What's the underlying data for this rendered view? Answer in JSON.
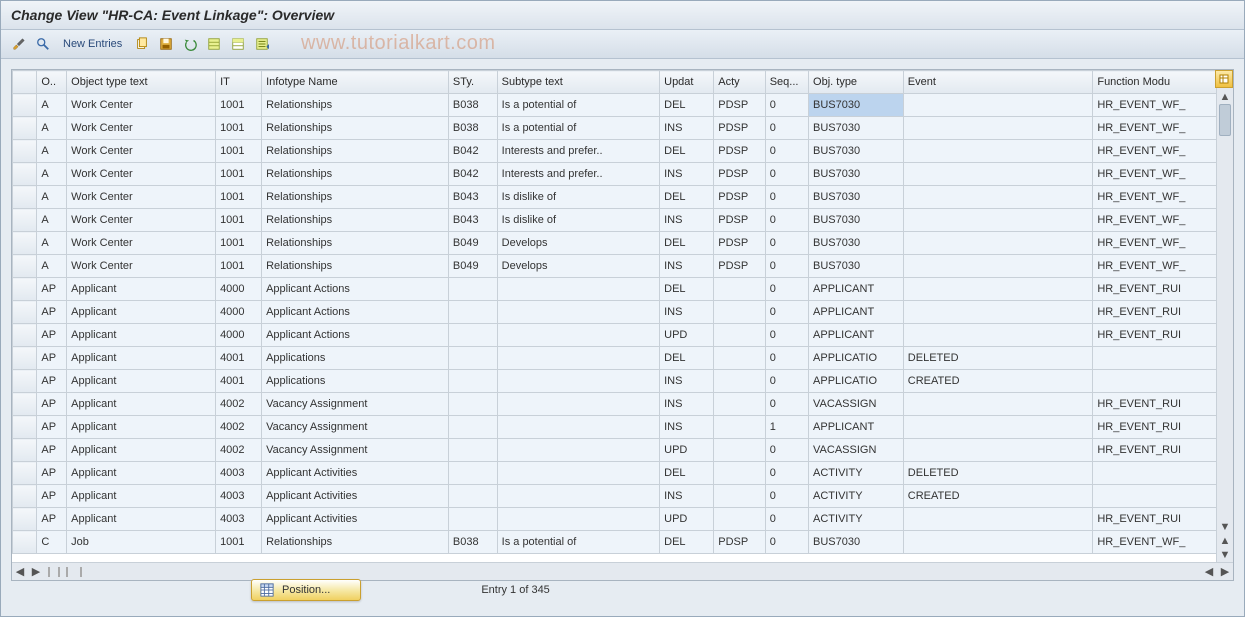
{
  "title": "Change View \"HR-CA: Event Linkage\": Overview",
  "watermark": "www.tutorialkart.com",
  "toolbar": {
    "new_entries_label": "New Entries"
  },
  "columns": {
    "sel": "",
    "o": "O..",
    "ott": "Object type text",
    "it": "IT",
    "iname": "Infotype Name",
    "sty": "STy.",
    "stxt": "Subtype text",
    "upd": "Updat",
    "acty": "Acty",
    "seq": "Seq...",
    "obj": "Obj. type",
    "event": "Event",
    "fm": "Function Modu"
  },
  "rows": [
    {
      "o": "A",
      "ott": "Work Center",
      "it": "1001",
      "iname": "Relationships",
      "sty": "B038",
      "stxt": "Is a potential of",
      "upd": "DEL",
      "acty": "PDSP",
      "seq": "0",
      "obj": "BUS7030",
      "event": "",
      "fm": "HR_EVENT_WF_"
    },
    {
      "o": "A",
      "ott": "Work Center",
      "it": "1001",
      "iname": "Relationships",
      "sty": "B038",
      "stxt": "Is a potential of",
      "upd": "INS",
      "acty": "PDSP",
      "seq": "0",
      "obj": "BUS7030",
      "event": "",
      "fm": "HR_EVENT_WF_"
    },
    {
      "o": "A",
      "ott": "Work Center",
      "it": "1001",
      "iname": "Relationships",
      "sty": "B042",
      "stxt": "Interests and prefer..",
      "upd": "DEL",
      "acty": "PDSP",
      "seq": "0",
      "obj": "BUS7030",
      "event": "",
      "fm": "HR_EVENT_WF_"
    },
    {
      "o": "A",
      "ott": "Work Center",
      "it": "1001",
      "iname": "Relationships",
      "sty": "B042",
      "stxt": "Interests and prefer..",
      "upd": "INS",
      "acty": "PDSP",
      "seq": "0",
      "obj": "BUS7030",
      "event": "",
      "fm": "HR_EVENT_WF_"
    },
    {
      "o": "A",
      "ott": "Work Center",
      "it": "1001",
      "iname": "Relationships",
      "sty": "B043",
      "stxt": "Is dislike of",
      "upd": "DEL",
      "acty": "PDSP",
      "seq": "0",
      "obj": "BUS7030",
      "event": "",
      "fm": "HR_EVENT_WF_"
    },
    {
      "o": "A",
      "ott": "Work Center",
      "it": "1001",
      "iname": "Relationships",
      "sty": "B043",
      "stxt": "Is dislike of",
      "upd": "INS",
      "acty": "PDSP",
      "seq": "0",
      "obj": "BUS7030",
      "event": "",
      "fm": "HR_EVENT_WF_"
    },
    {
      "o": "A",
      "ott": "Work Center",
      "it": "1001",
      "iname": "Relationships",
      "sty": "B049",
      "stxt": "Develops",
      "upd": "DEL",
      "acty": "PDSP",
      "seq": "0",
      "obj": "BUS7030",
      "event": "",
      "fm": "HR_EVENT_WF_"
    },
    {
      "o": "A",
      "ott": "Work Center",
      "it": "1001",
      "iname": "Relationships",
      "sty": "B049",
      "stxt": "Develops",
      "upd": "INS",
      "acty": "PDSP",
      "seq": "0",
      "obj": "BUS7030",
      "event": "",
      "fm": "HR_EVENT_WF_"
    },
    {
      "o": "AP",
      "ott": "Applicant",
      "it": "4000",
      "iname": "Applicant Actions",
      "sty": "",
      "stxt": "",
      "upd": "DEL",
      "acty": "",
      "seq": "0",
      "obj": "APPLICANT",
      "event": "",
      "fm": "HR_EVENT_RUI"
    },
    {
      "o": "AP",
      "ott": "Applicant",
      "it": "4000",
      "iname": "Applicant Actions",
      "sty": "",
      "stxt": "",
      "upd": "INS",
      "acty": "",
      "seq": "0",
      "obj": "APPLICANT",
      "event": "",
      "fm": "HR_EVENT_RUI"
    },
    {
      "o": "AP",
      "ott": "Applicant",
      "it": "4000",
      "iname": "Applicant Actions",
      "sty": "",
      "stxt": "",
      "upd": "UPD",
      "acty": "",
      "seq": "0",
      "obj": "APPLICANT",
      "event": "",
      "fm": "HR_EVENT_RUI"
    },
    {
      "o": "AP",
      "ott": "Applicant",
      "it": "4001",
      "iname": "Applications",
      "sty": "",
      "stxt": "",
      "upd": "DEL",
      "acty": "",
      "seq": "0",
      "obj": "APPLICATIO",
      "event": "DELETED",
      "fm": ""
    },
    {
      "o": "AP",
      "ott": "Applicant",
      "it": "4001",
      "iname": "Applications",
      "sty": "",
      "stxt": "",
      "upd": "INS",
      "acty": "",
      "seq": "0",
      "obj": "APPLICATIO",
      "event": "CREATED",
      "fm": ""
    },
    {
      "o": "AP",
      "ott": "Applicant",
      "it": "4002",
      "iname": "Vacancy Assignment",
      "sty": "",
      "stxt": "",
      "upd": "INS",
      "acty": "",
      "seq": "0",
      "obj": "VACASSIGN",
      "event": "",
      "fm": "HR_EVENT_RUI"
    },
    {
      "o": "AP",
      "ott": "Applicant",
      "it": "4002",
      "iname": "Vacancy Assignment",
      "sty": "",
      "stxt": "",
      "upd": "INS",
      "acty": "",
      "seq": "1",
      "obj": "APPLICANT",
      "event": "",
      "fm": "HR_EVENT_RUI"
    },
    {
      "o": "AP",
      "ott": "Applicant",
      "it": "4002",
      "iname": "Vacancy Assignment",
      "sty": "",
      "stxt": "",
      "upd": "UPD",
      "acty": "",
      "seq": "0",
      "obj": "VACASSIGN",
      "event": "",
      "fm": "HR_EVENT_RUI"
    },
    {
      "o": "AP",
      "ott": "Applicant",
      "it": "4003",
      "iname": "Applicant Activities",
      "sty": "",
      "stxt": "",
      "upd": "DEL",
      "acty": "",
      "seq": "0",
      "obj": "ACTIVITY",
      "event": "DELETED",
      "fm": ""
    },
    {
      "o": "AP",
      "ott": "Applicant",
      "it": "4003",
      "iname": "Applicant Activities",
      "sty": "",
      "stxt": "",
      "upd": "INS",
      "acty": "",
      "seq": "0",
      "obj": "ACTIVITY",
      "event": "CREATED",
      "fm": ""
    },
    {
      "o": "AP",
      "ott": "Applicant",
      "it": "4003",
      "iname": "Applicant Activities",
      "sty": "",
      "stxt": "",
      "upd": "UPD",
      "acty": "",
      "seq": "0",
      "obj": "ACTIVITY",
      "event": "",
      "fm": "HR_EVENT_RUI"
    },
    {
      "o": "C",
      "ott": "Job",
      "it": "1001",
      "iname": "Relationships",
      "sty": "B038",
      "stxt": "Is a potential of",
      "upd": "DEL",
      "acty": "PDSP",
      "seq": "0",
      "obj": "BUS7030",
      "event": "",
      "fm": "HR_EVENT_WF_"
    }
  ],
  "footer": {
    "position_label": "Position...",
    "entry_text": "Entry 1 of 345"
  }
}
